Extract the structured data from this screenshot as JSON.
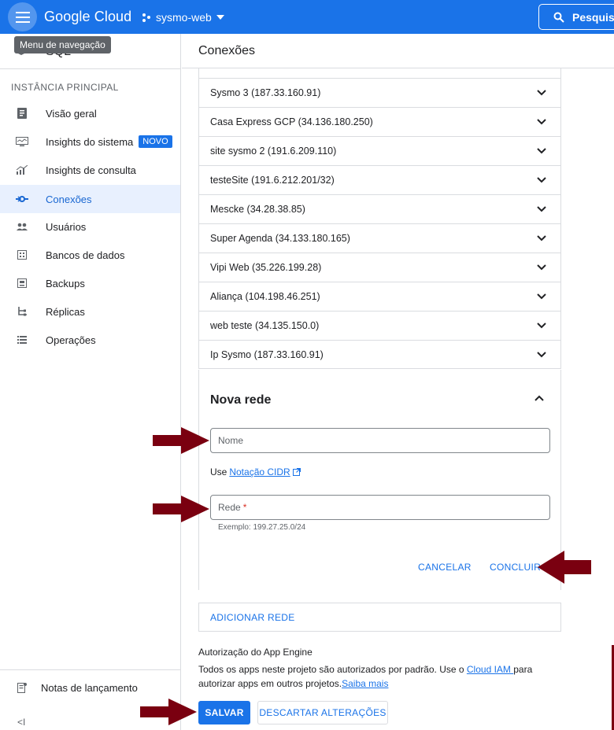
{
  "topbar": {
    "logo": "Google Cloud",
    "project": "sysmo-web",
    "search_label": "Pesquisa"
  },
  "tooltip": "Menu de navegação",
  "sidebar": {
    "product": "SQL",
    "section": "INSTÂNCIA PRINCIPAL",
    "items": [
      {
        "label": "Visão geral",
        "icon": "overview-icon"
      },
      {
        "label": "Insights do sistema",
        "icon": "monitor-icon",
        "badge": "NOVO"
      },
      {
        "label": "Insights de consulta",
        "icon": "chart-icon"
      },
      {
        "label": "Conexões",
        "icon": "connections-icon",
        "active": true
      },
      {
        "label": "Usuários",
        "icon": "users-icon"
      },
      {
        "label": "Bancos de dados",
        "icon": "databases-icon"
      },
      {
        "label": "Backups",
        "icon": "backup-icon"
      },
      {
        "label": "Réplicas",
        "icon": "replicas-icon"
      },
      {
        "label": "Operações",
        "icon": "list-icon"
      }
    ],
    "release_notes": "Notas de lançamento",
    "collapse": "<I"
  },
  "main": {
    "title": "Conexões",
    "networks": [
      "Sysmo 3 (187.33.160.91)",
      "Casa Express GCP (34.136.180.250)",
      "site sysmo 2 (191.6.209.110)",
      "testeSite (191.6.212.201/32)",
      "Mescke (34.28.38.85)",
      "Super Agenda (34.133.180.165)",
      "Vipi Web (35.226.199.28)",
      "Aliança (104.198.46.251)",
      "web teste (34.135.150.0)",
      "Ip Sysmo (187.33.160.91)"
    ],
    "new_network": {
      "title": "Nova rede",
      "name_placeholder": "Nome",
      "use_label": "Use",
      "cidr_link": "Notação CIDR",
      "network_placeholder": "Rede",
      "required_mark": "*",
      "example": "Exemplo: 199.27.25.0/24",
      "cancel": "CANCELAR",
      "done": "CONCLUIR"
    },
    "add_network": "ADICIONAR REDE",
    "app_engine": {
      "title": "Autorização do App Engine",
      "text_1": "Todos os apps neste projeto são autorizados por padrão. Use o ",
      "link_iam": "Cloud IAM ",
      "text_2": "para autorizar apps em outros projetos.",
      "link_more": "Saiba mais"
    },
    "save": "SALVAR",
    "discard": "DESCARTAR ALTERAÇÕES"
  },
  "colors": {
    "brand_blue": "#1a73e8",
    "annotation_arrow": "#7a0010"
  }
}
